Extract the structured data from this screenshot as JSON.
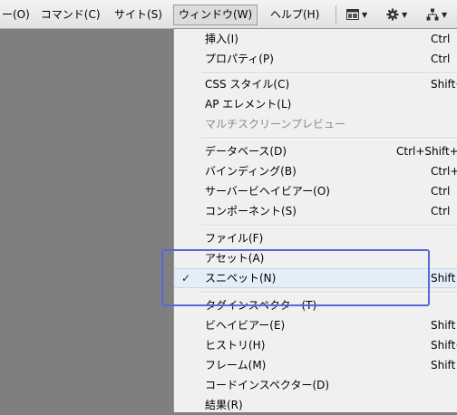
{
  "menubar": {
    "command": "ー(O)　コマンド(C)",
    "site": "サイト(S)",
    "window": "ウィンドウ(W)",
    "help": "ヘルプ(H)",
    "icons": [
      "layout-icon",
      "gear-icon",
      "site-icon"
    ]
  },
  "menu": {
    "items": [
      {
        "label": "挿入(I)",
        "shortcut": "Ctrl"
      },
      {
        "label": "プロパティ(P)",
        "shortcut": "Ctrl"
      },
      {
        "label": "CSS スタイル(C)",
        "shortcut": "Shift+"
      },
      {
        "label": "AP エレメント(L)",
        "shortcut": ""
      },
      {
        "label": "マルチスクリーンプレビュー",
        "shortcut": "",
        "disabled": true
      },
      {
        "label": "データベース(D)",
        "shortcut": "Ctrl+Shift+"
      },
      {
        "label": "バインディング(B)",
        "shortcut": "Ctrl+"
      },
      {
        "label": "サーバービヘイビアー(O)",
        "shortcut": "Ctrl"
      },
      {
        "label": "コンポーネント(S)",
        "shortcut": "Ctrl"
      },
      {
        "label": "ファイル(F)",
        "shortcut": ""
      },
      {
        "label": "アセット(A)",
        "shortcut": ""
      },
      {
        "label": "スニペット(N)",
        "shortcut": "Shift",
        "checked": true
      },
      {
        "label": "タグインスペクター(T)",
        "shortcut": ""
      },
      {
        "label": "ビヘイビアー(E)",
        "shortcut": "Shift"
      },
      {
        "label": "ヒストリ(H)",
        "shortcut": "Shift+"
      },
      {
        "label": "フレーム(M)",
        "shortcut": "Shift"
      },
      {
        "label": "コードインスペクター(D)",
        "shortcut": ""
      },
      {
        "label": "結果(R)",
        "shortcut": ""
      }
    ],
    "check_glyph": "✓"
  }
}
